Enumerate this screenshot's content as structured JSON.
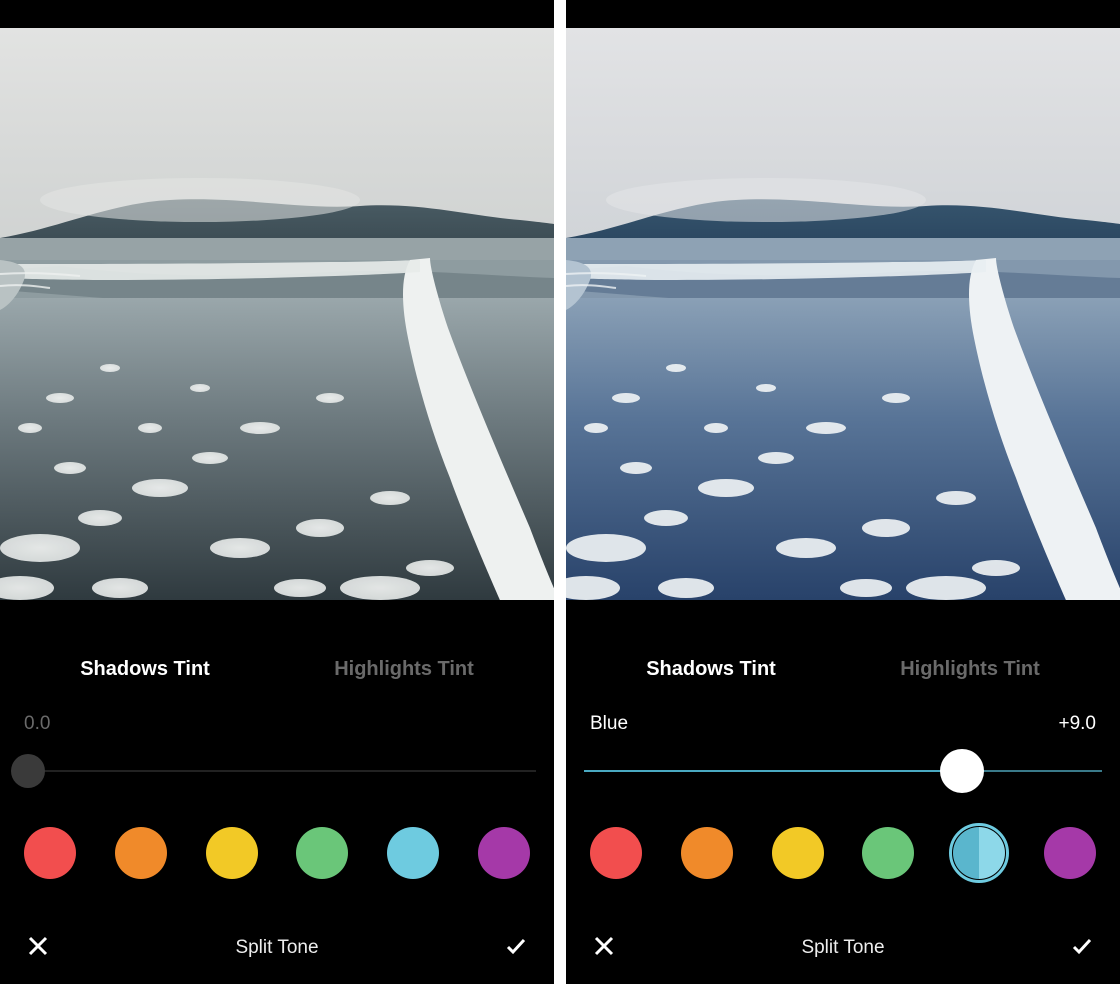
{
  "screens": [
    {
      "tabs": {
        "shadows": "Shadows Tint",
        "highlights": "Highlights Tint",
        "active": "shadows"
      },
      "slider": {
        "value_label": "0.0",
        "color_label": "",
        "thumb_color": "#3a3a3a",
        "percent": 2,
        "track_fill": "#222"
      },
      "swatches": [
        {
          "name": "red",
          "color": "#F24E4E",
          "selected": false
        },
        {
          "name": "orange",
          "color": "#F08A2A",
          "selected": false
        },
        {
          "name": "yellow",
          "color": "#F2C926",
          "selected": false
        },
        {
          "name": "green",
          "color": "#6AC679",
          "selected": false
        },
        {
          "name": "blue",
          "color": "#6ECBE0",
          "selected": false
        },
        {
          "name": "purple",
          "color": "#A539A8",
          "selected": false
        }
      ],
      "bottom": {
        "label": "Split Tone"
      },
      "photo_tint": "none"
    },
    {
      "tabs": {
        "shadows": "Shadows Tint",
        "highlights": "Highlights Tint",
        "active": "shadows"
      },
      "slider": {
        "value_label": "+9.0",
        "color_label": "Blue",
        "thumb_color": "#ffffff",
        "percent": 73,
        "track_fill": "#4aa9c2"
      },
      "swatches": [
        {
          "name": "red",
          "color": "#F24E4E",
          "selected": false
        },
        {
          "name": "orange",
          "color": "#F08A2A",
          "selected": false
        },
        {
          "name": "yellow",
          "color": "#F2C926",
          "selected": false
        },
        {
          "name": "green",
          "color": "#6AC679",
          "selected": false
        },
        {
          "name": "blue",
          "color": "#6ECBE0",
          "selected": true,
          "split_left": "#5AB6CD",
          "split_right": "#8DD8E9"
        },
        {
          "name": "purple",
          "color": "#A539A8",
          "selected": false
        }
      ],
      "bottom": {
        "label": "Split Tone"
      },
      "photo_tint": "blue"
    }
  ]
}
